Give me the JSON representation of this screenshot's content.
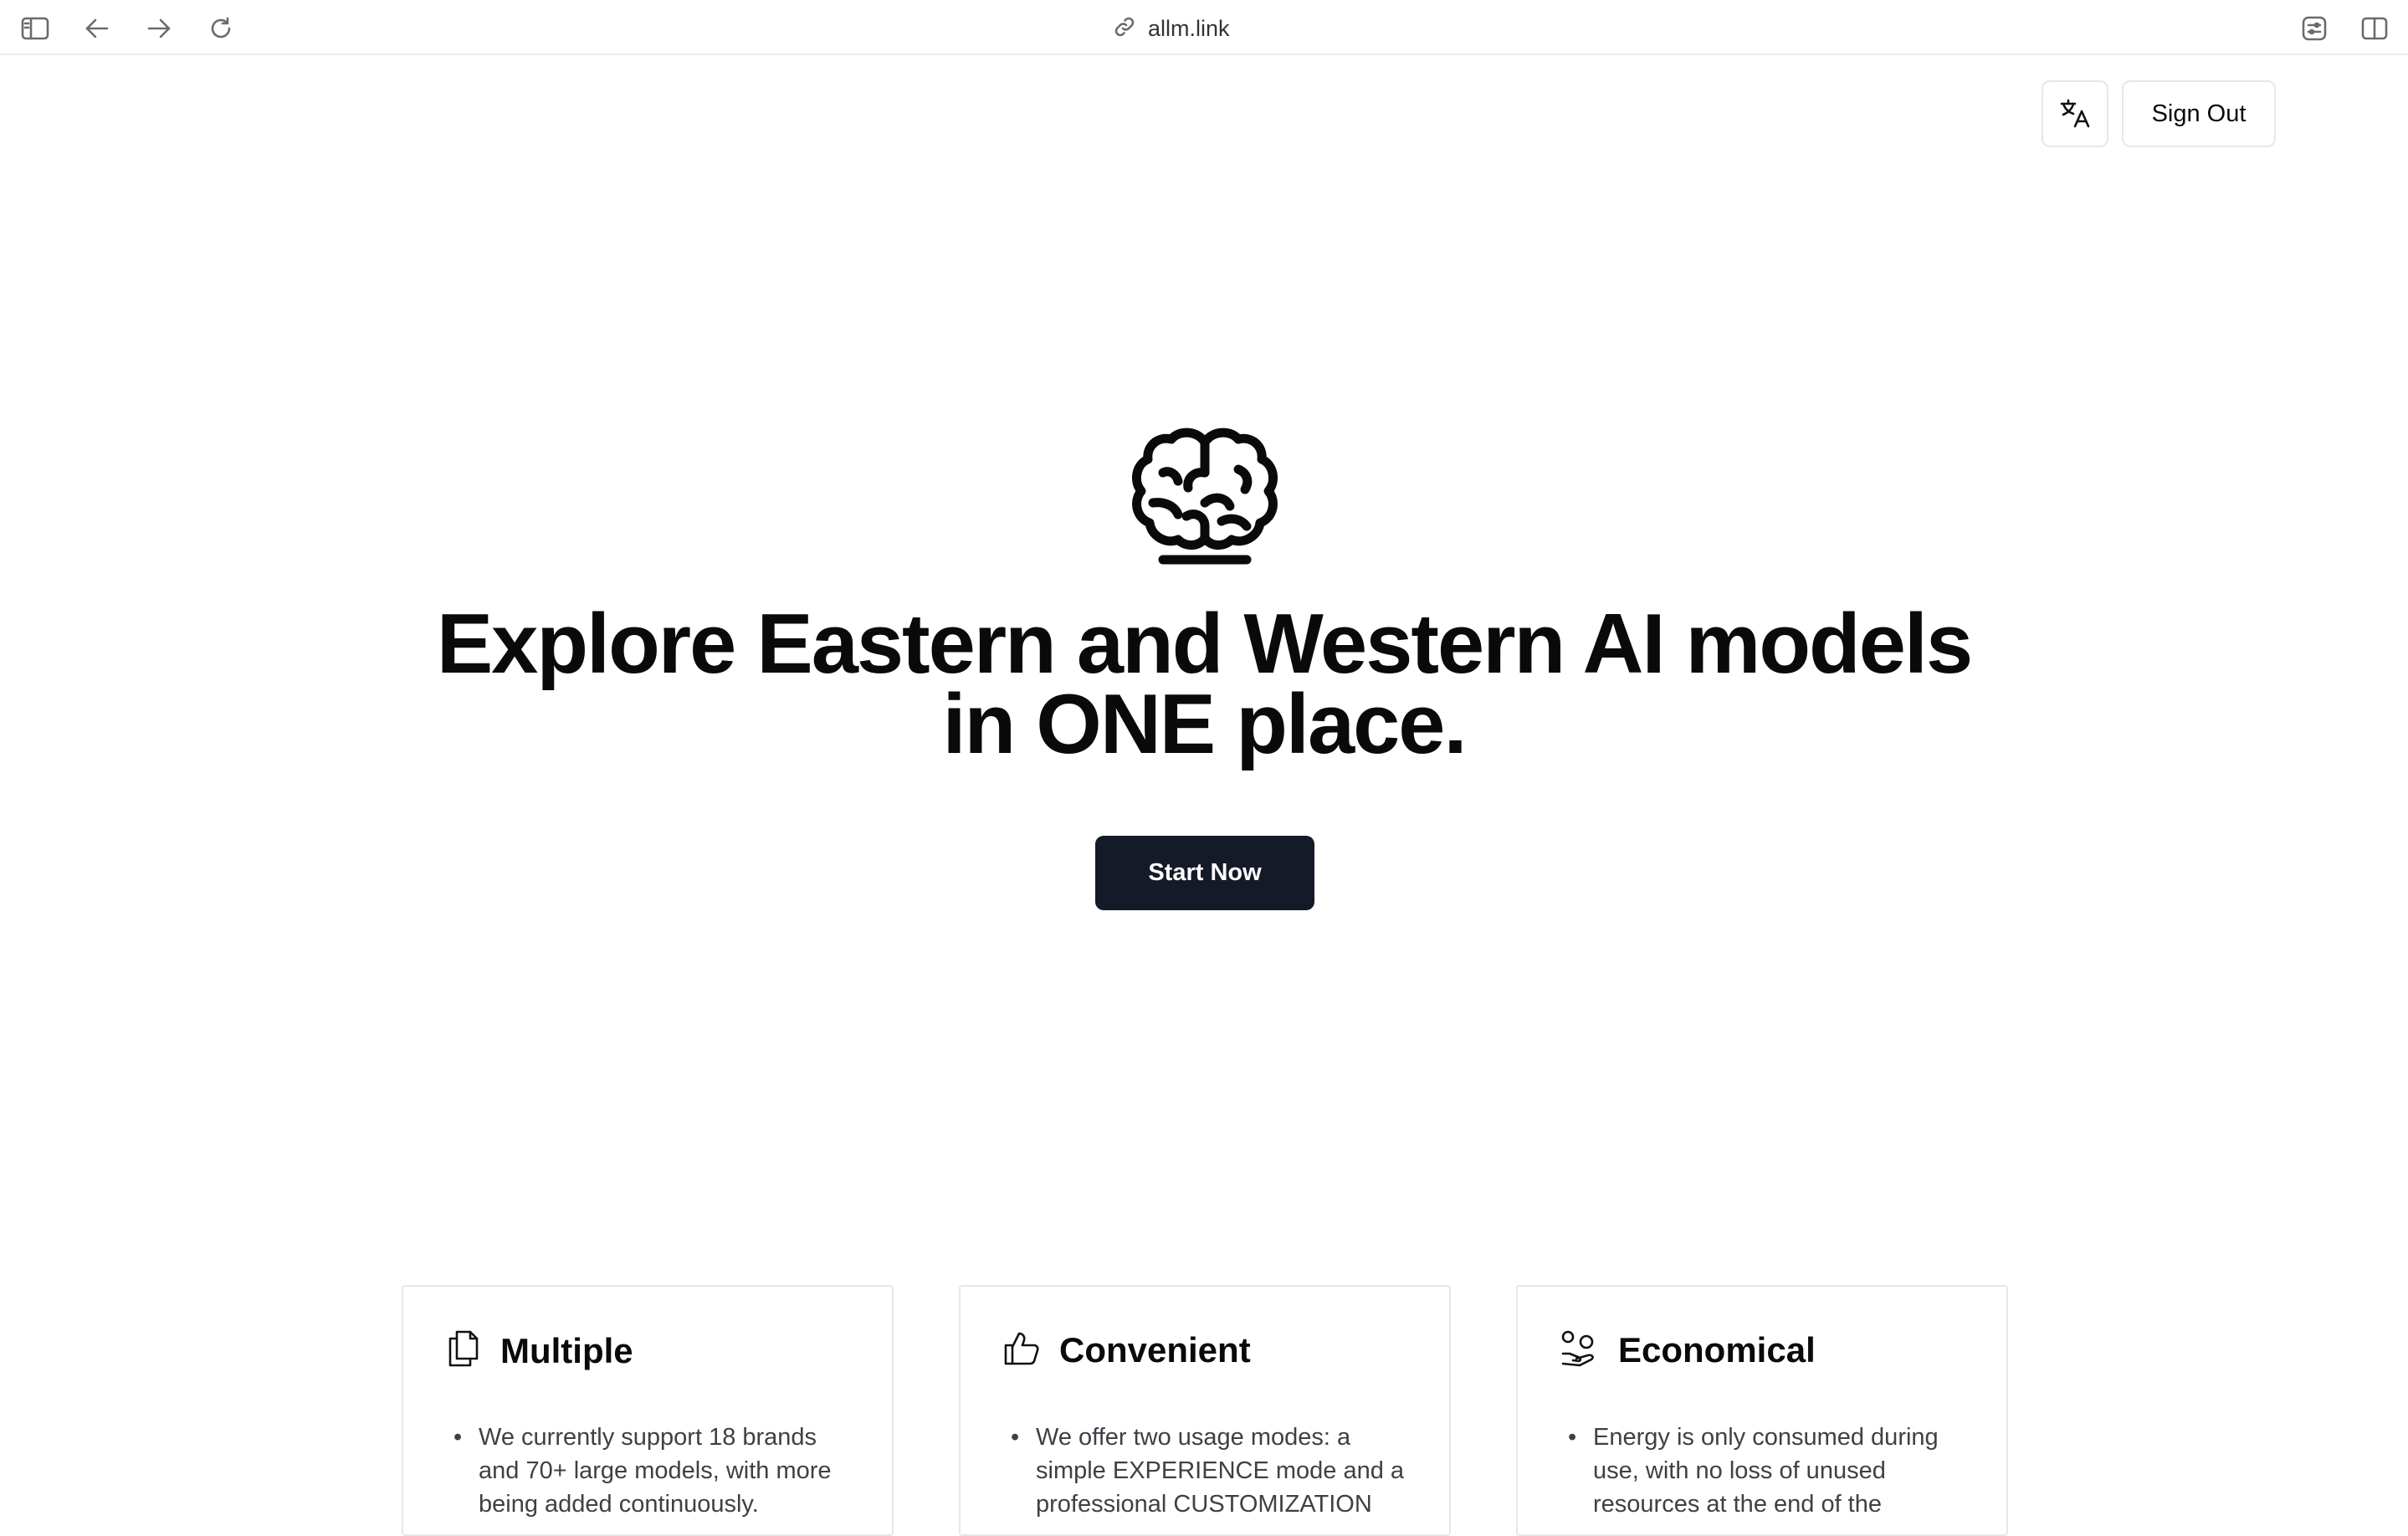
{
  "browser": {
    "url": "allm.link",
    "icons": [
      "sidebar-icon",
      "back-icon",
      "forward-icon",
      "reload-icon",
      "link-icon",
      "extension-icon",
      "split-view-icon"
    ]
  },
  "header": {
    "language_icon": "translate-icon",
    "sign_out_label": "Sign Out"
  },
  "hero": {
    "icon": "brain-icon",
    "headline_line1": "Explore Eastern and Western AI models",
    "headline_line2": "in ONE place.",
    "cta_label": "Start Now",
    "cta_color": "#141a27"
  },
  "features": [
    {
      "icon": "documents-icon",
      "title": "Multiple",
      "bullet": "We currently support 18 brands and 70+ large models, with more being added continuously."
    },
    {
      "icon": "thumbs-up-icon",
      "title": "Convenient",
      "bullet": "We offer two usage modes: a simple EXPERIENCE mode and a professional CUSTOMIZATION"
    },
    {
      "icon": "hand-coins-icon",
      "title": "Economical",
      "bullet": "Energy is only consumed during use, with no loss of unused resources at the end of the"
    }
  ]
}
